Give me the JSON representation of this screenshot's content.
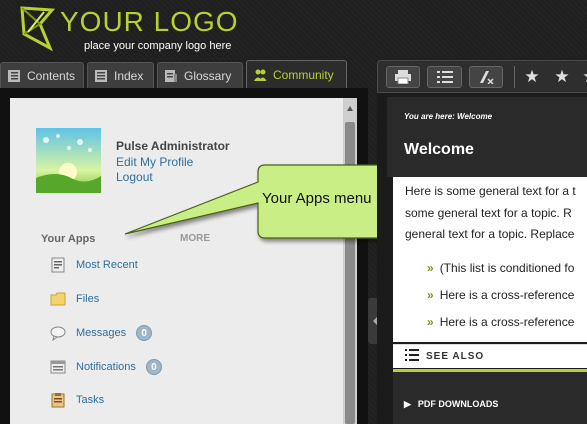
{
  "header": {
    "logo_text": "YOUR LOGO",
    "tagline": "place your company logo here"
  },
  "tabs": [
    {
      "label": "Contents",
      "icon": "book-icon",
      "active": false
    },
    {
      "label": "Index",
      "icon": "list-icon",
      "active": false
    },
    {
      "label": "Glossary",
      "icon": "glossary-icon",
      "active": false
    },
    {
      "label": "Community",
      "icon": "people-icon",
      "active": true
    }
  ],
  "profile": {
    "name": "Pulse Administrator",
    "edit_link": "Edit My Profile",
    "logout_link": "Logout"
  },
  "apps": {
    "heading": "Your Apps",
    "more": "MORE",
    "items": [
      {
        "label": "Most Recent",
        "icon": "recent-icon",
        "badge": null
      },
      {
        "label": "Files",
        "icon": "folder-icon",
        "badge": null
      },
      {
        "label": "Messages",
        "icon": "speech-bubble-icon",
        "badge": "0"
      },
      {
        "label": "Notifications",
        "icon": "notifications-icon",
        "badge": "0"
      },
      {
        "label": "Tasks",
        "icon": "clipboard-icon",
        "badge": null
      }
    ]
  },
  "callout": {
    "text": "Your Apps menu"
  },
  "topic": {
    "breadcrumb": "You are here: Welcome",
    "title": "Welcome",
    "body_lines": [
      "Here is some general text for a t",
      "some general text for a topic. R",
      "general text for a topic. Replace"
    ],
    "bullets": [
      "(This list is conditioned fo",
      "Here is a cross-reference",
      "Here is a cross-reference"
    ],
    "see_also": "SEE ALSO",
    "pdf_downloads": "PDF DOWNLOADS"
  },
  "toolbar": {
    "buttons": [
      "print-icon",
      "toc-list-icon",
      "clear-highlight-icon"
    ],
    "stars": [
      "★",
      "★",
      "★"
    ]
  },
  "colors": {
    "accent": "#b5d232",
    "link": "#2e6e9e",
    "badge": "#9fb6c8"
  }
}
